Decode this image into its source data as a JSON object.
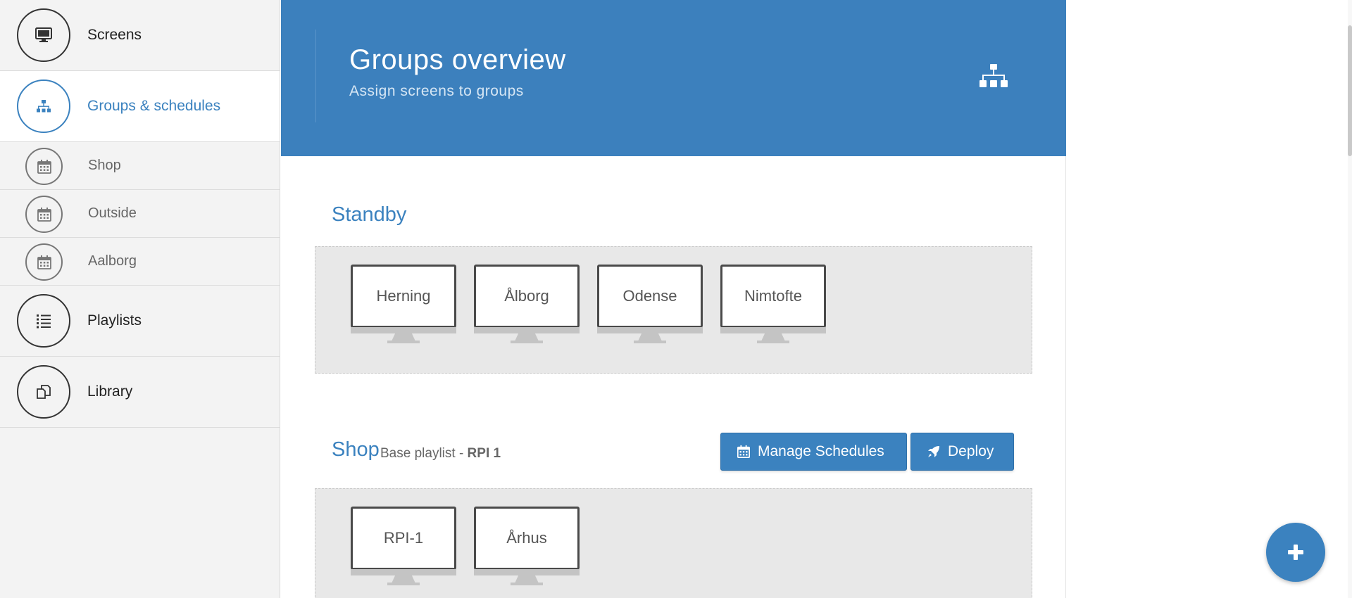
{
  "sidebar": {
    "items": [
      {
        "label": "Screens",
        "icon": "monitor-icon"
      },
      {
        "label": "Groups & schedules",
        "icon": "sitemap-icon",
        "active": true
      },
      {
        "label": "Playlists",
        "icon": "list-icon"
      },
      {
        "label": "Library",
        "icon": "copy-icon"
      }
    ],
    "sub_items": [
      {
        "label": "Shop",
        "icon": "calendar-icon"
      },
      {
        "label": "Outside",
        "icon": "calendar-icon"
      },
      {
        "label": "Aalborg",
        "icon": "calendar-icon"
      }
    ]
  },
  "header": {
    "title": "Groups overview",
    "subtitle": "Assign screens to groups",
    "icon": "sitemap-icon"
  },
  "groups": [
    {
      "title": "Standby",
      "screens": [
        "Herning",
        "Ålborg",
        "Odense",
        "Nimtofte"
      ]
    },
    {
      "title": "Shop",
      "meta_prefix": "Base playlist - ",
      "meta_value": "RPI 1",
      "buttons": {
        "manage_schedules": "Manage Schedules",
        "deploy": "Deploy"
      },
      "screens": [
        "RPI-1",
        "Århus"
      ]
    }
  ],
  "fab": {
    "icon": "plus-icon"
  },
  "colors": {
    "accent": "#3b82bf",
    "header_bg": "#3c80bd",
    "sidebar_bg": "#f3f3f3",
    "dropzone_bg": "#e8e8e8"
  }
}
